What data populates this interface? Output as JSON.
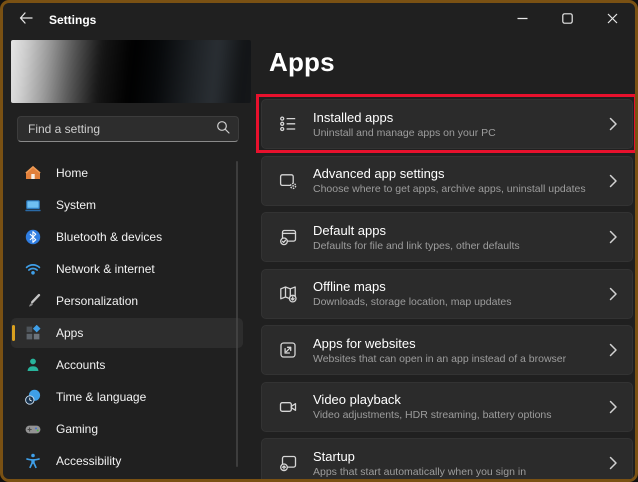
{
  "window": {
    "title": "Settings"
  },
  "sidebar": {
    "search_placeholder": "Find a setting",
    "items": [
      {
        "label": "Home",
        "icon": "home-icon"
      },
      {
        "label": "System",
        "icon": "system-icon"
      },
      {
        "label": "Bluetooth & devices",
        "icon": "bluetooth-icon"
      },
      {
        "label": "Network & internet",
        "icon": "network-icon"
      },
      {
        "label": "Personalization",
        "icon": "personalization-icon"
      },
      {
        "label": "Apps",
        "icon": "apps-icon",
        "selected": true
      },
      {
        "label": "Accounts",
        "icon": "accounts-icon"
      },
      {
        "label": "Time & language",
        "icon": "time-language-icon"
      },
      {
        "label": "Gaming",
        "icon": "gaming-icon"
      },
      {
        "label": "Accessibility",
        "icon": "accessibility-icon"
      }
    ]
  },
  "main": {
    "title": "Apps",
    "cards": [
      {
        "title": "Installed apps",
        "subtitle": "Uninstall and manage apps on your PC",
        "icon": "installed-apps-icon",
        "highlighted": true
      },
      {
        "title": "Advanced app settings",
        "subtitle": "Choose where to get apps, archive apps, uninstall updates",
        "icon": "advanced-app-settings-icon"
      },
      {
        "title": "Default apps",
        "subtitle": "Defaults for file and link types, other defaults",
        "icon": "default-apps-icon"
      },
      {
        "title": "Offline maps",
        "subtitle": "Downloads, storage location, map updates",
        "icon": "offline-maps-icon"
      },
      {
        "title": "Apps for websites",
        "subtitle": "Websites that can open in an app instead of a browser",
        "icon": "apps-for-websites-icon"
      },
      {
        "title": "Video playback",
        "subtitle": "Video adjustments, HDR streaming, battery options",
        "icon": "video-playback-icon"
      },
      {
        "title": "Startup",
        "subtitle": "Apps that start automatically when you sign in",
        "icon": "startup-icon"
      }
    ]
  },
  "colors": {
    "accent_pill": "#d9a01f",
    "highlight_red": "#e8112d",
    "window_border": "#7a5113",
    "card_bg": "#2b2b2b",
    "page_bg": "#202020"
  }
}
